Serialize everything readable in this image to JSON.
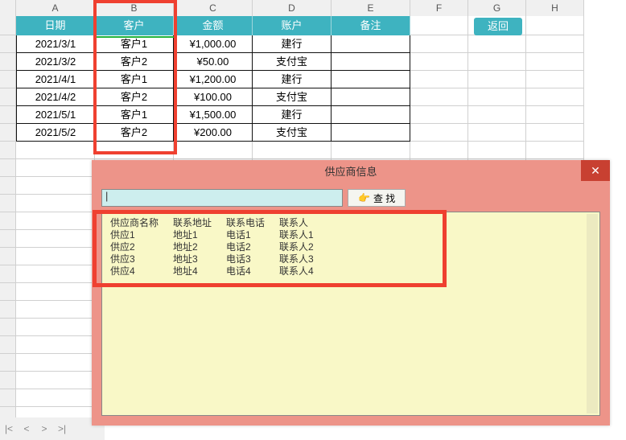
{
  "columns": [
    "A",
    "B",
    "C",
    "D",
    "E",
    "F",
    "G",
    "H"
  ],
  "headers": {
    "date": "日期",
    "customer": "客户",
    "amount": "金额",
    "account": "账户",
    "remark": "备注"
  },
  "return_button": "返回",
  "rows": [
    {
      "date": "2021/3/1",
      "customer": "客户1",
      "amount": "¥1,000.00",
      "account": "建行",
      "remark": ""
    },
    {
      "date": "2021/3/2",
      "customer": "客户2",
      "amount": "¥50.00",
      "account": "支付宝",
      "remark": ""
    },
    {
      "date": "2021/4/1",
      "customer": "客户1",
      "amount": "¥1,200.00",
      "account": "建行",
      "remark": ""
    },
    {
      "date": "2021/4/2",
      "customer": "客户2",
      "amount": "¥100.00",
      "account": "支付宝",
      "remark": ""
    },
    {
      "date": "2021/5/1",
      "customer": "客户1",
      "amount": "¥1,500.00",
      "account": "建行",
      "remark": ""
    },
    {
      "date": "2021/5/2",
      "customer": "客户2",
      "amount": "¥200.00",
      "account": "支付宝",
      "remark": ""
    }
  ],
  "modal": {
    "title": "供应商信息",
    "search_label": "查 找",
    "search_value": "",
    "cursor": "|",
    "list_headers": {
      "name": "供应商名称",
      "addr": "联系地址",
      "phone": "联系电话",
      "contact": "联系人"
    },
    "list": [
      {
        "name": "供应1",
        "addr": "地址1",
        "phone": "电话1",
        "contact": "联系人1"
      },
      {
        "name": "供应2",
        "addr": "地址2",
        "phone": "电话2",
        "contact": "联系人2"
      },
      {
        "name": "供应3",
        "addr": "地址3",
        "phone": "电话3",
        "contact": "联系人3"
      },
      {
        "name": "供应4",
        "addr": "地址4",
        "phone": "电话4",
        "contact": "联系人4"
      }
    ]
  },
  "sheetnav": {
    "first": "|<",
    "prev": "<",
    "next": ">",
    "last": ">|"
  }
}
